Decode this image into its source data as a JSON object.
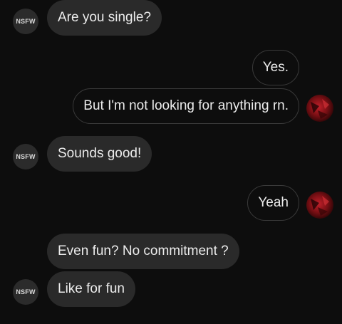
{
  "contact": {
    "avatar_text": "NSFW"
  },
  "messages": [
    {
      "sender": "contact",
      "text": "Are you single?"
    },
    {
      "sender": "me",
      "text": "Yes."
    },
    {
      "sender": "me",
      "text": "But I'm not looking for anything rn."
    },
    {
      "sender": "contact",
      "text": "Sounds good!"
    },
    {
      "sender": "me",
      "text": "Yeah"
    },
    {
      "sender": "contact",
      "text": "Even fun? No commitment ?"
    },
    {
      "sender": "contact",
      "text": "Like for fun"
    }
  ],
  "colors": {
    "background": "#0d0d0d",
    "incoming_bubble": "#2a2a2a",
    "outgoing_border": "#3a3a3a",
    "text": "#ececec"
  }
}
